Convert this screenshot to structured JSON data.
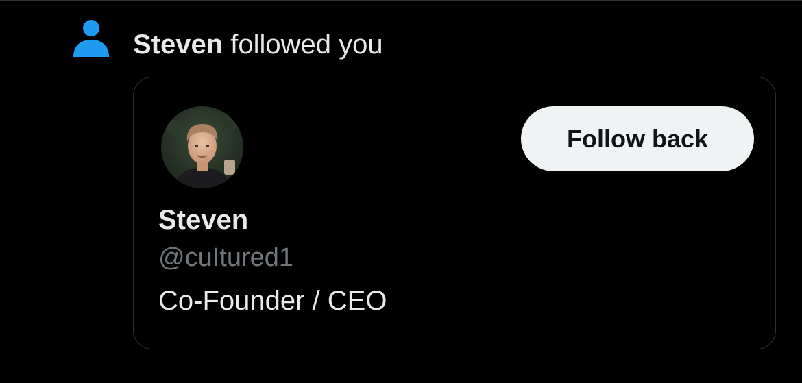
{
  "notification": {
    "icon": "person-icon",
    "icon_color": "#1d9bf0",
    "actor_name": "Steven",
    "action_text": " followed you"
  },
  "profile_card": {
    "avatar": "profile-photo",
    "display_name": "Steven",
    "handle": "@cuItured1",
    "bio": "Co-Founder / CEO",
    "follow_button_label": "Follow back"
  },
  "colors": {
    "background": "#000000",
    "primary_text": "#e7e9ea",
    "secondary_text": "#71767b",
    "border": "#2f3336",
    "button_bg": "#eff3f4",
    "button_text": "#0f1419"
  }
}
